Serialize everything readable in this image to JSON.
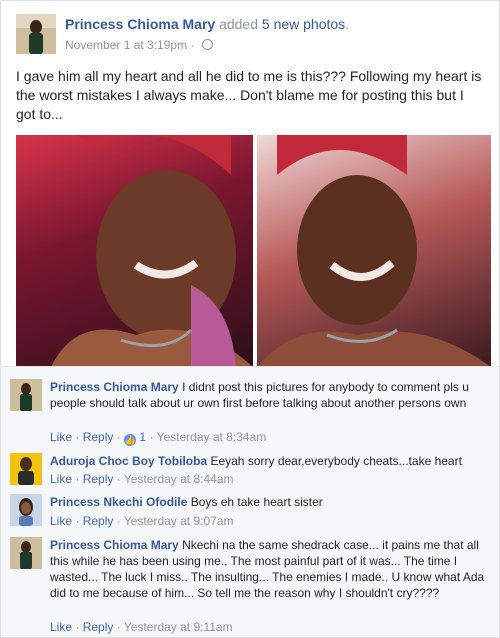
{
  "post": {
    "author": "Princess Chioma Mary",
    "action_prefix": "added",
    "action_count": "5 new photos",
    "action_suffix": ".",
    "timestamp": "November 1 at 3:19pm",
    "middot": "·",
    "text": "I gave him all my heart and all he did to me is this??? Following my heart is the worst mistakes I always make... Don't blame me for posting this but I got to..."
  },
  "actions": {
    "like": "Like",
    "reply": "Reply",
    "sep": "·"
  },
  "comments": [
    {
      "author": "Princess Chioma Mary",
      "text": "I didnt post this pictures for anybody to comment pls u people should talk about ur own first before talking about another persons own",
      "likes": "1",
      "time": "Yesterday at 8:34am"
    },
    {
      "author": "Aduroja Choc Boy Tobiloba",
      "text": "Eeyah sorry dear,everybody cheats...take heart",
      "time": "Yesterday at 8:44am"
    },
    {
      "author": "Princess Nkechi Ofodile",
      "text": "Boys eh take heart sister",
      "time": "Yesterday at 9:07am"
    },
    {
      "author": "Princess Chioma Mary",
      "text": "Nkechi na the same shedrack case... it pains me that all this while he has been using me.. The most painful part of it was... The time I wasted... The luck I miss.. The insulting... The enemies I made.. U know what Ada did to me because of him... So tell me the reason why I shouldn't cry????",
      "time": "Yesterday at 9:11am"
    }
  ]
}
